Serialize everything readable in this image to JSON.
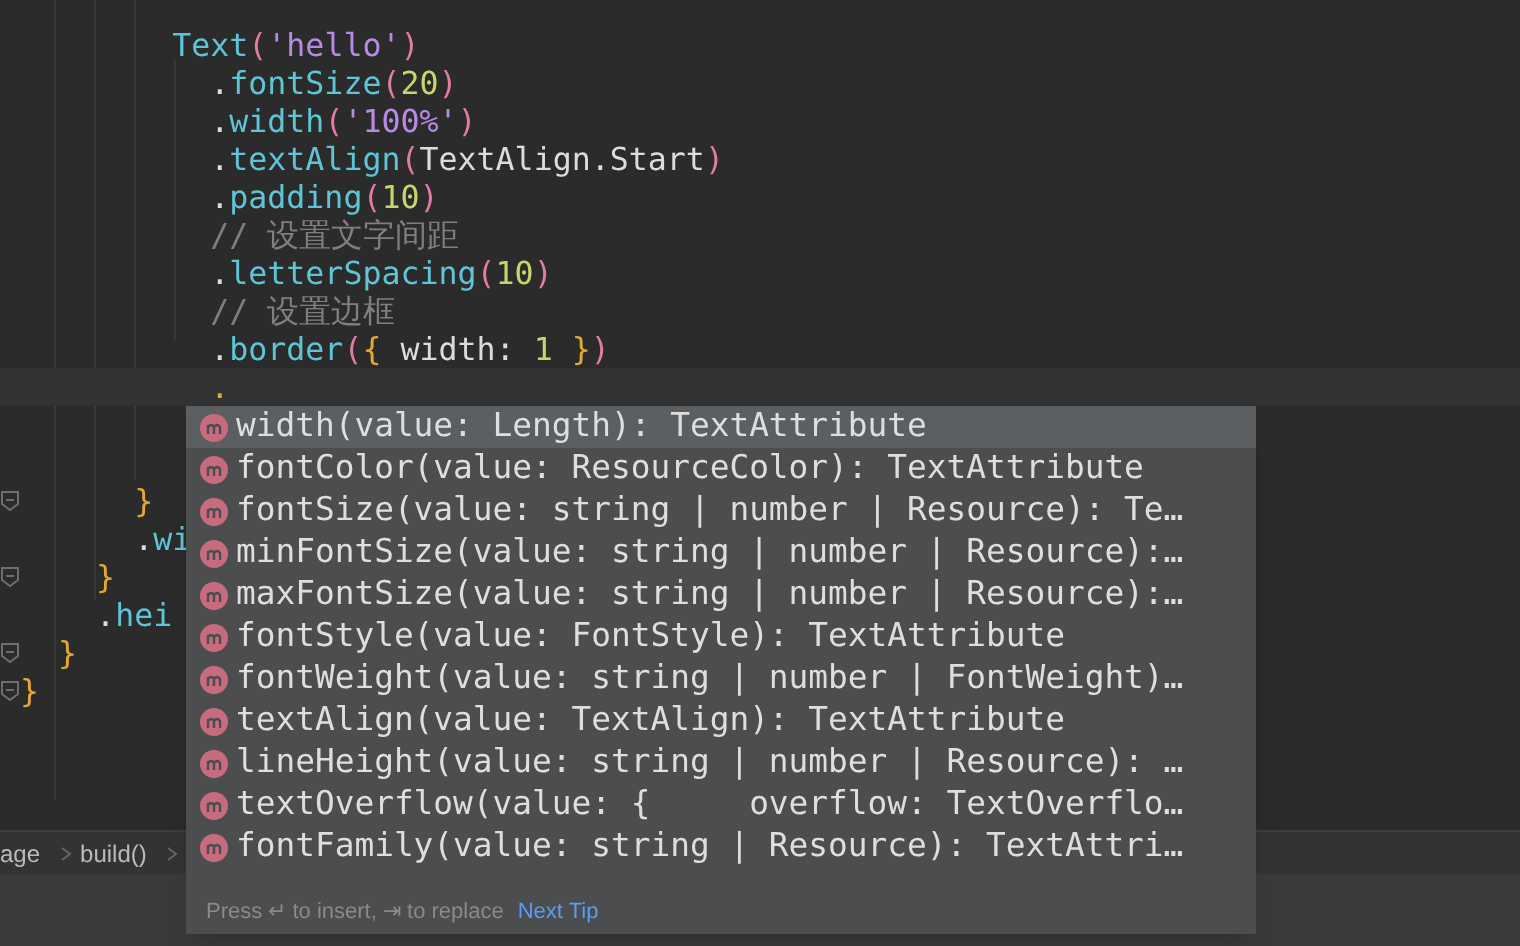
{
  "code_lines": [
    {
      "text": "        Text('hello')"
    },
    {
      "text": "          .fontSize(20)"
    },
    {
      "text": "          .width('100%')"
    },
    {
      "text": "          .textAlign(TextAlign.Start)"
    },
    {
      "text": "          .padding(10)"
    },
    {
      "text": "          // 设置文字间距"
    },
    {
      "text": "          .letterSpacing(10)"
    },
    {
      "text": "          // 设置边框"
    },
    {
      "text": "          .border({ width: 1 })"
    },
    {
      "text": "          .",
      "current": true
    },
    {
      "kind": "blank"
    },
    {
      "kind": "blank"
    },
    {
      "text": "      }",
      "fold_marker": true
    },
    {
      "text": "      .wi"
    },
    {
      "text": "    }",
      "fold_marker": true
    },
    {
      "text": "    .hei"
    },
    {
      "text": "  }",
      "fold_marker": true
    },
    {
      "text": "}",
      "fold_marker": true
    }
  ],
  "completion_popup": {
    "items": [
      {
        "label": "width(value: Length): TextAttribute",
        "selected": true
      },
      {
        "label": "fontColor(value: ResourceColor): TextAttribute",
        "selected": false
      },
      {
        "label": "fontSize(value: string | number | Resource): Te…",
        "selected": false
      },
      {
        "label": "minFontSize(value: string | number | Resource):…",
        "selected": false
      },
      {
        "label": "maxFontSize(value: string | number | Resource):…",
        "selected": false
      },
      {
        "label": "fontStyle(value: FontStyle): TextAttribute",
        "selected": false
      },
      {
        "label": "fontWeight(value: string | number | FontWeight)…",
        "selected": false
      },
      {
        "label": "textAlign(value: TextAlign): TextAttribute",
        "selected": false
      },
      {
        "label": "lineHeight(value: string | number | Resource): …",
        "selected": false
      },
      {
        "label": "textOverflow(value: {     overflow: TextOverflo…",
        "selected": false
      },
      {
        "label": "fontFamily(value: string | Resource): TextAttri…",
        "selected": false
      }
    ],
    "hint": "Press ↵ to insert, ⇥ to replace",
    "next_tip": "Next Tip"
  },
  "breadcrumbs": [
    "age",
    "build()"
  ]
}
